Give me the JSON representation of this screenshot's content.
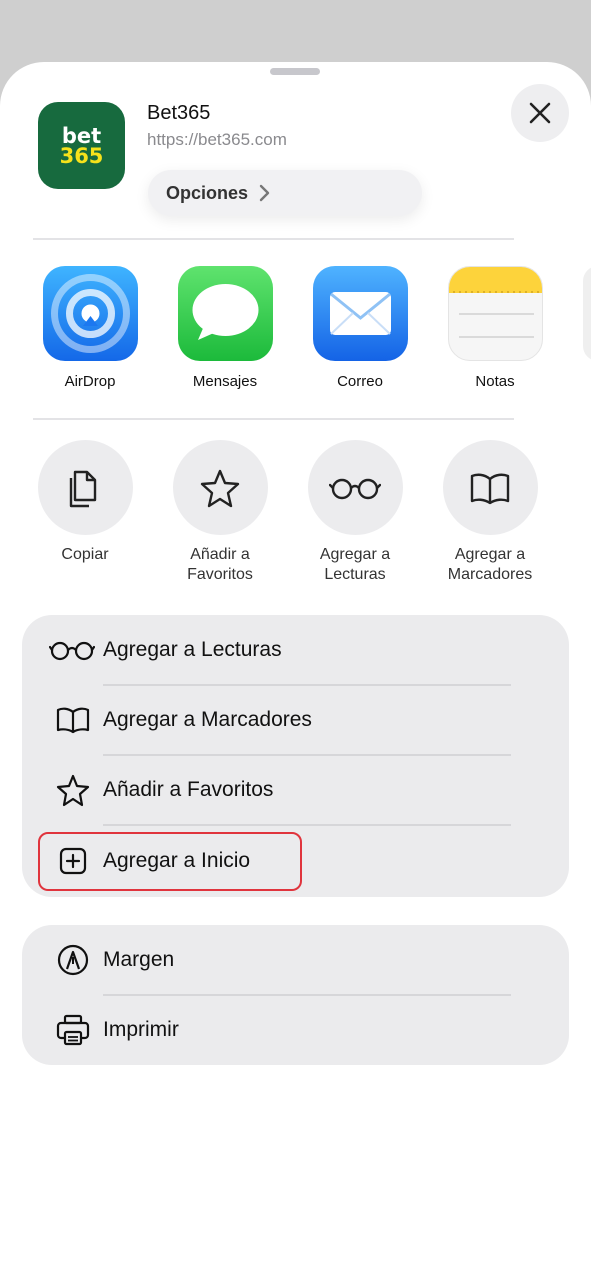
{
  "header": {
    "app_title": "Bet365",
    "app_url": "https://bet365.com",
    "icon_line1": "bet",
    "icon_line2": "365",
    "options_label": "Opciones"
  },
  "share_targets": [
    {
      "label": "AirDrop",
      "icon": "airdrop-icon"
    },
    {
      "label": "Mensajes",
      "icon": "messages-icon"
    },
    {
      "label": "Correo",
      "icon": "mail-icon"
    },
    {
      "label": "Notas",
      "icon": "notes-icon"
    }
  ],
  "quick_actions": [
    {
      "line1": "Copiar",
      "line2": "",
      "icon": "copy-icon"
    },
    {
      "line1": "Añadir a",
      "line2": "Favoritos",
      "icon": "star-icon"
    },
    {
      "line1": "Agregar a",
      "line2": "Lecturas",
      "icon": "glasses-icon"
    },
    {
      "line1": "Agregar a",
      "line2": "Marcadores",
      "icon": "book-icon"
    }
  ],
  "menu_group1": [
    {
      "label": "Agregar a Lecturas",
      "icon": "glasses-icon"
    },
    {
      "label": "Agregar a Marcadores",
      "icon": "book-icon"
    },
    {
      "label": "Añadir a Favoritos",
      "icon": "star-icon"
    },
    {
      "label": "Agregar a Inicio",
      "icon": "add-square-icon",
      "highlighted": true
    }
  ],
  "menu_group2": [
    {
      "label": "Margen",
      "icon": "markup-icon"
    },
    {
      "label": "Imprimir",
      "icon": "printer-icon"
    }
  ],
  "colors": {
    "app_icon_bg": "#176a3e",
    "app_icon_accent": "#f6e21b",
    "highlight_border": "#e0343d"
  }
}
